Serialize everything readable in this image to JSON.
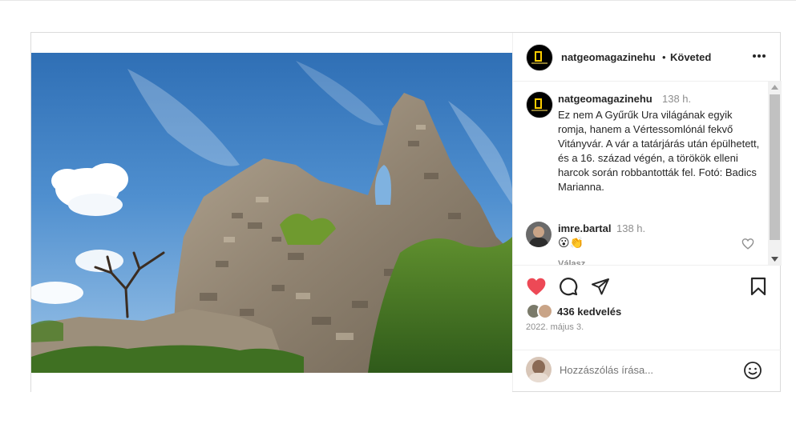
{
  "post": {
    "author": "natgeomagazinehu",
    "separator": "•",
    "follow_status": "Követed",
    "more_icon": "more-horizontal-icon",
    "caption": {
      "author": "natgeomagazinehu",
      "time": "138 h.",
      "text": "Ez nem A Gyűrűk Ura világának egyik romja, hanem a Vértessomlónál fekvő Vitányvár. A vár a tatárjárás után épülhetett, és a 16. század végén, a törökök elleni harcok során robbantották fel. Fotó: Badics Marianna."
    },
    "comments": [
      {
        "author": "imre.bartal",
        "time": "138 h.",
        "text": "😮👏",
        "reply_label": "Válasz"
      }
    ],
    "actions": {
      "like_icon": "heart-filled-icon",
      "comment_icon": "comment-icon",
      "share_icon": "share-icon",
      "save_icon": "bookmark-icon",
      "like_color": "#ed4956"
    },
    "likes": "436 kedvelés",
    "date": "2022. május 3.",
    "add_comment_placeholder": "Hozzászólás írása...",
    "emoji_icon": "emoji-smile-icon"
  }
}
